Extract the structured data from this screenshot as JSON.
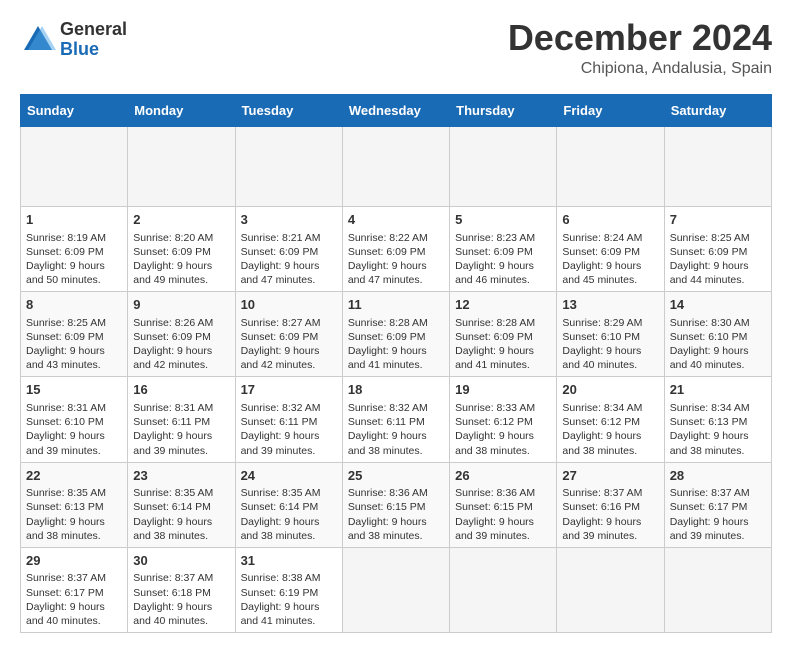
{
  "header": {
    "logo_general": "General",
    "logo_blue": "Blue",
    "month_title": "December 2024",
    "location": "Chipiona, Andalusia, Spain"
  },
  "calendar": {
    "days_of_week": [
      "Sunday",
      "Monday",
      "Tuesday",
      "Wednesday",
      "Thursday",
      "Friday",
      "Saturday"
    ],
    "weeks": [
      [
        {
          "day": "",
          "empty": true
        },
        {
          "day": "",
          "empty": true
        },
        {
          "day": "",
          "empty": true
        },
        {
          "day": "",
          "empty": true
        },
        {
          "day": "",
          "empty": true
        },
        {
          "day": "",
          "empty": true
        },
        {
          "day": "",
          "empty": true
        }
      ],
      [
        {
          "day": "1",
          "sunrise": "8:19 AM",
          "sunset": "6:09 PM",
          "daylight": "9 hours and 50 minutes."
        },
        {
          "day": "2",
          "sunrise": "8:20 AM",
          "sunset": "6:09 PM",
          "daylight": "9 hours and 49 minutes."
        },
        {
          "day": "3",
          "sunrise": "8:21 AM",
          "sunset": "6:09 PM",
          "daylight": "9 hours and 47 minutes."
        },
        {
          "day": "4",
          "sunrise": "8:22 AM",
          "sunset": "6:09 PM",
          "daylight": "9 hours and 47 minutes."
        },
        {
          "day": "5",
          "sunrise": "8:23 AM",
          "sunset": "6:09 PM",
          "daylight": "9 hours and 46 minutes."
        },
        {
          "day": "6",
          "sunrise": "8:24 AM",
          "sunset": "6:09 PM",
          "daylight": "9 hours and 45 minutes."
        },
        {
          "day": "7",
          "sunrise": "8:25 AM",
          "sunset": "6:09 PM",
          "daylight": "9 hours and 44 minutes."
        }
      ],
      [
        {
          "day": "8",
          "sunrise": "8:25 AM",
          "sunset": "6:09 PM",
          "daylight": "9 hours and 43 minutes."
        },
        {
          "day": "9",
          "sunrise": "8:26 AM",
          "sunset": "6:09 PM",
          "daylight": "9 hours and 42 minutes."
        },
        {
          "day": "10",
          "sunrise": "8:27 AM",
          "sunset": "6:09 PM",
          "daylight": "9 hours and 42 minutes."
        },
        {
          "day": "11",
          "sunrise": "8:28 AM",
          "sunset": "6:09 PM",
          "daylight": "9 hours and 41 minutes."
        },
        {
          "day": "12",
          "sunrise": "8:28 AM",
          "sunset": "6:09 PM",
          "daylight": "9 hours and 41 minutes."
        },
        {
          "day": "13",
          "sunrise": "8:29 AM",
          "sunset": "6:10 PM",
          "daylight": "9 hours and 40 minutes."
        },
        {
          "day": "14",
          "sunrise": "8:30 AM",
          "sunset": "6:10 PM",
          "daylight": "9 hours and 40 minutes."
        }
      ],
      [
        {
          "day": "15",
          "sunrise": "8:31 AM",
          "sunset": "6:10 PM",
          "daylight": "9 hours and 39 minutes."
        },
        {
          "day": "16",
          "sunrise": "8:31 AM",
          "sunset": "6:11 PM",
          "daylight": "9 hours and 39 minutes."
        },
        {
          "day": "17",
          "sunrise": "8:32 AM",
          "sunset": "6:11 PM",
          "daylight": "9 hours and 39 minutes."
        },
        {
          "day": "18",
          "sunrise": "8:32 AM",
          "sunset": "6:11 PM",
          "daylight": "9 hours and 38 minutes."
        },
        {
          "day": "19",
          "sunrise": "8:33 AM",
          "sunset": "6:12 PM",
          "daylight": "9 hours and 38 minutes."
        },
        {
          "day": "20",
          "sunrise": "8:34 AM",
          "sunset": "6:12 PM",
          "daylight": "9 hours and 38 minutes."
        },
        {
          "day": "21",
          "sunrise": "8:34 AM",
          "sunset": "6:13 PM",
          "daylight": "9 hours and 38 minutes."
        }
      ],
      [
        {
          "day": "22",
          "sunrise": "8:35 AM",
          "sunset": "6:13 PM",
          "daylight": "9 hours and 38 minutes."
        },
        {
          "day": "23",
          "sunrise": "8:35 AM",
          "sunset": "6:14 PM",
          "daylight": "9 hours and 38 minutes."
        },
        {
          "day": "24",
          "sunrise": "8:35 AM",
          "sunset": "6:14 PM",
          "daylight": "9 hours and 38 minutes."
        },
        {
          "day": "25",
          "sunrise": "8:36 AM",
          "sunset": "6:15 PM",
          "daylight": "9 hours and 38 minutes."
        },
        {
          "day": "26",
          "sunrise": "8:36 AM",
          "sunset": "6:15 PM",
          "daylight": "9 hours and 39 minutes."
        },
        {
          "day": "27",
          "sunrise": "8:37 AM",
          "sunset": "6:16 PM",
          "daylight": "9 hours and 39 minutes."
        },
        {
          "day": "28",
          "sunrise": "8:37 AM",
          "sunset": "6:17 PM",
          "daylight": "9 hours and 39 minutes."
        }
      ],
      [
        {
          "day": "29",
          "sunrise": "8:37 AM",
          "sunset": "6:17 PM",
          "daylight": "9 hours and 40 minutes."
        },
        {
          "day": "30",
          "sunrise": "8:37 AM",
          "sunset": "6:18 PM",
          "daylight": "9 hours and 40 minutes."
        },
        {
          "day": "31",
          "sunrise": "8:38 AM",
          "sunset": "6:19 PM",
          "daylight": "9 hours and 41 minutes."
        },
        {
          "day": "",
          "empty": true
        },
        {
          "day": "",
          "empty": true
        },
        {
          "day": "",
          "empty": true
        },
        {
          "day": "",
          "empty": true
        }
      ]
    ]
  }
}
